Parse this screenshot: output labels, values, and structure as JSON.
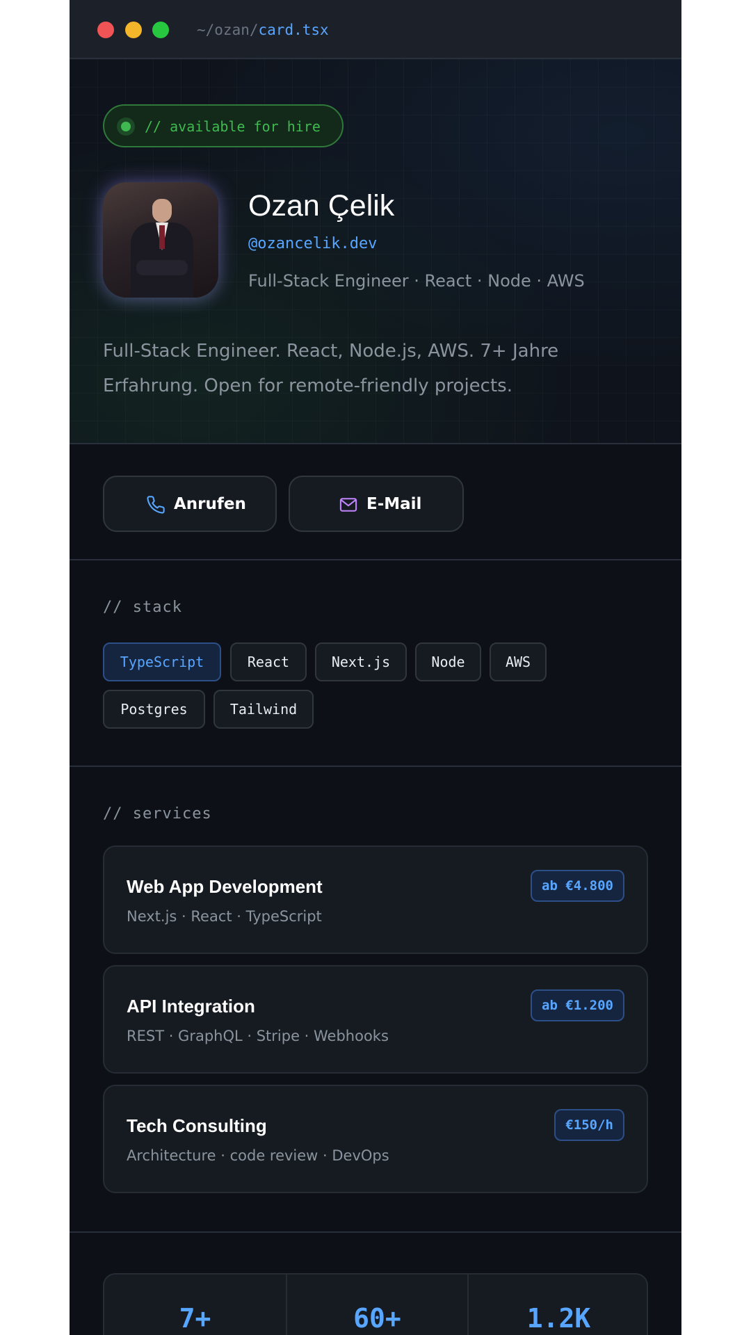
{
  "titlebar": {
    "path_prefix": "~/ozan/",
    "file": "card.tsx"
  },
  "hero": {
    "badge": "// available for hire",
    "name": "Ozan Çelik",
    "handle": "@ozancelik.dev",
    "role": "Full-Stack Engineer · React · Node · AWS",
    "bio": "Full-Stack Engineer. React, Node.js, AWS. 7+ Jahre Erfahrung. Open for remote-friendly projects."
  },
  "actions": {
    "call_label": "Anrufen",
    "email_label": "E-Mail"
  },
  "stack": {
    "label": "// stack",
    "items": [
      "TypeScript",
      "React",
      "Next.js",
      "Node",
      "AWS",
      "Postgres",
      "Tailwind"
    ]
  },
  "services": {
    "label": "// services",
    "items": [
      {
        "title": "Web App Development",
        "sub": "Next.js · React · TypeScript",
        "price": "ab €4.800"
      },
      {
        "title": "API Integration",
        "sub": "REST · GraphQL · Stripe · Webhooks",
        "price": "ab €1.200"
      },
      {
        "title": "Tech Consulting",
        "sub": "Architecture · code review · DevOps",
        "price": "€150/h"
      }
    ]
  },
  "stats": {
    "items": [
      "7+",
      "60+",
      "1.2K"
    ]
  },
  "colors": {
    "accent": "#58a6ff",
    "success": "#3fb950",
    "background": "#0d1117",
    "surface": "#161b22"
  },
  "icons": {
    "call": "phone-icon",
    "email": "mail-icon"
  }
}
